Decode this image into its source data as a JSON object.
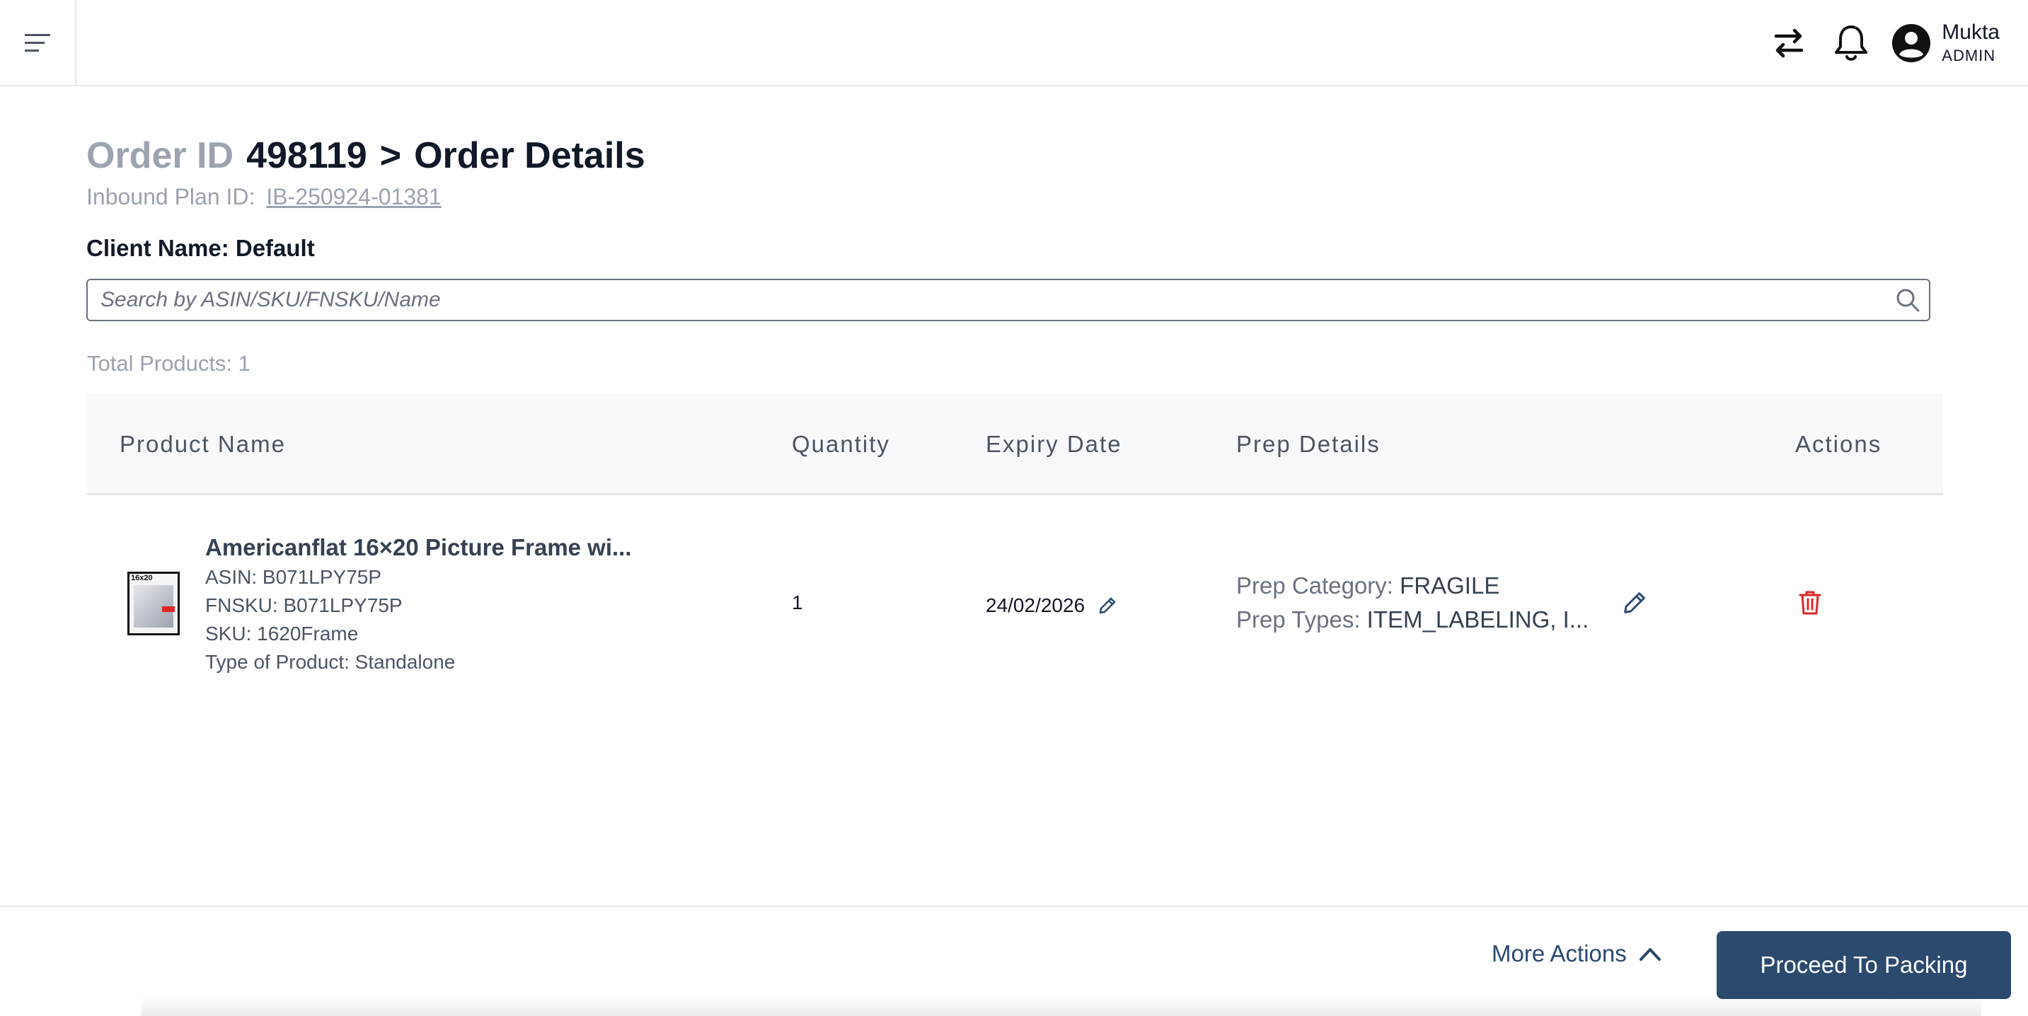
{
  "topbar": {
    "user_name": "Mukta",
    "user_role": "ADMIN"
  },
  "header": {
    "title_prefix": "Order ID",
    "order_id": "498119",
    "separator": ">",
    "page_title": "Order Details",
    "plan_label": "Inbound Plan ID:",
    "plan_id": "IB-250924-01381",
    "client_name": "Client Name: Default"
  },
  "search": {
    "placeholder": "Search by ASIN/SKU/FNSKU/Name",
    "value": ""
  },
  "total_products": "Total Products: 1",
  "table": {
    "columns": [
      "Product Name",
      "Quantity",
      "Expiry Date",
      "Prep Details",
      "Actions"
    ],
    "rows": [
      {
        "name": "Americanflat 16×20 Picture Frame wi...",
        "asin": "ASIN: B071LPY75P",
        "fnsku": "FNSKU: B071LPY75P",
        "sku": "SKU: 1620Frame",
        "type": "Type of Product: Standalone",
        "thumb_text": "16x20",
        "quantity": "1",
        "expiry": "24/02/2026",
        "prep_category_label": "Prep Category:",
        "prep_category": "FRAGILE",
        "prep_types_label": "Prep Types:",
        "prep_types": "ITEM_LABELING, I..."
      }
    ]
  },
  "footer": {
    "more_actions": "More Actions",
    "proceed": "Proceed To Packing"
  },
  "colors": {
    "primary": "#2c4a6e",
    "delete": "#dc2626",
    "muted": "#9ca3af"
  }
}
